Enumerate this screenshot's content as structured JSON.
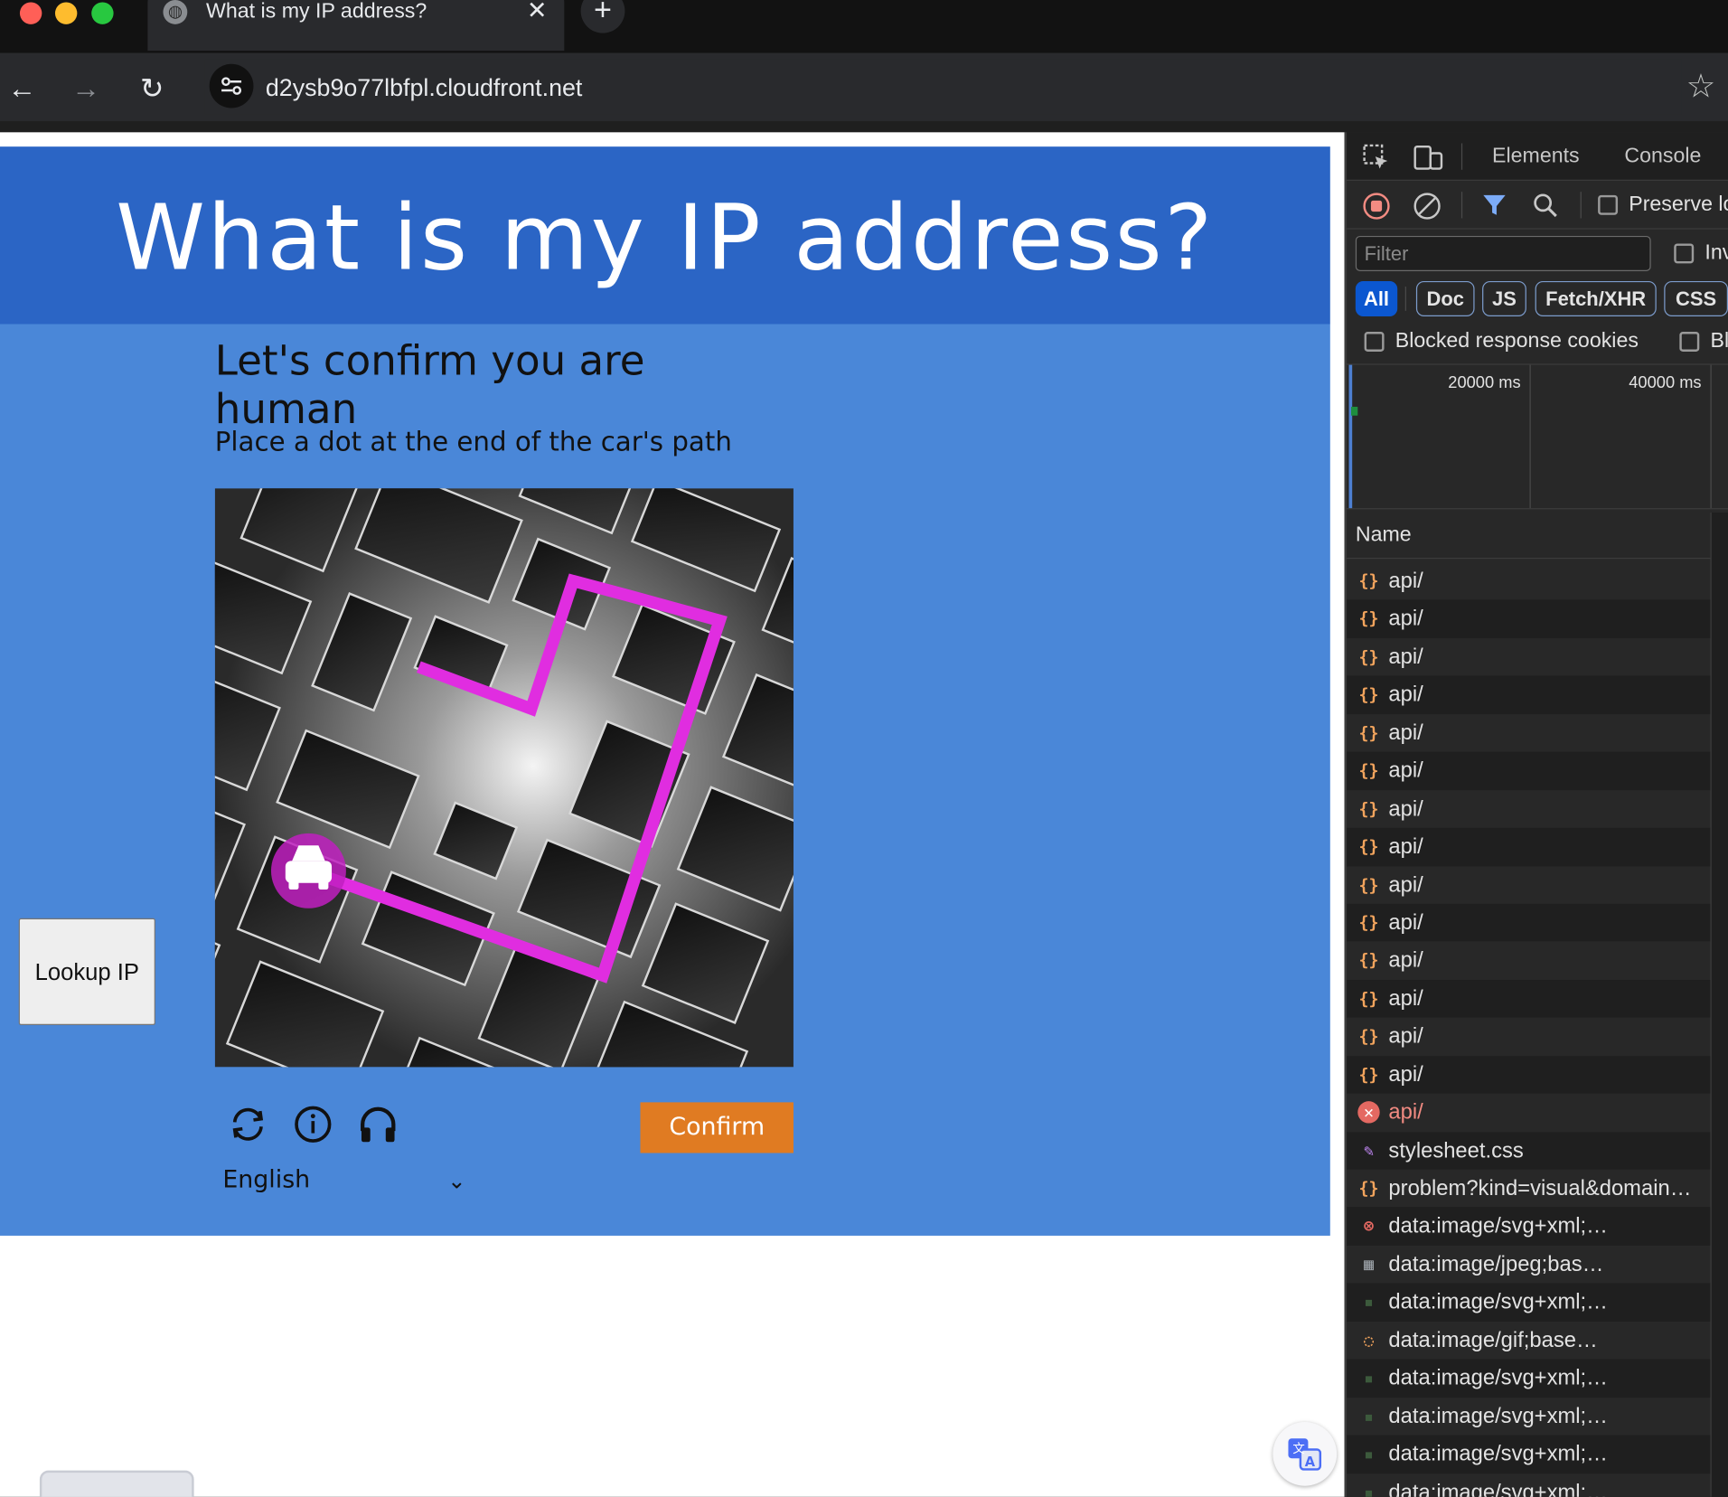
{
  "browser": {
    "tab_title": "What is my IP address?",
    "tab_close": "✕",
    "new_tab": "+",
    "url": "d2ysb9o77lbfpl.cloudfront.net",
    "back": "←",
    "forward": "→",
    "reload": "↻",
    "bookmark": "☆"
  },
  "page": {
    "heading": "What is my IP address?",
    "lookup_button": "Lookup IP"
  },
  "captcha": {
    "title": "Let's confirm you are human",
    "instruction": "Place a dot at the end of the car's path",
    "confirm_label": "Confirm",
    "language": "English",
    "icons": [
      "refresh-icon",
      "info-icon",
      "audio-icon"
    ]
  },
  "devtools": {
    "tabs": [
      "Elements",
      "Console"
    ],
    "preserve_log": "Preserve lo",
    "filter_placeholder": "Filter",
    "invert": "Inv",
    "chips": [
      "All",
      "Doc",
      "JS",
      "Fetch/XHR",
      "CSS"
    ],
    "blocked_cookies": "Blocked response cookies",
    "blocked_requests": "Bl",
    "timeline_labels": [
      "20000 ms",
      "40000 ms"
    ],
    "name_header": "Name",
    "requests": [
      {
        "name": "api/",
        "type": "fetch"
      },
      {
        "name": "api/",
        "type": "fetch"
      },
      {
        "name": "api/",
        "type": "fetch"
      },
      {
        "name": "api/",
        "type": "fetch"
      },
      {
        "name": "api/",
        "type": "fetch"
      },
      {
        "name": "api/",
        "type": "fetch"
      },
      {
        "name": "api/",
        "type": "fetch"
      },
      {
        "name": "api/",
        "type": "fetch"
      },
      {
        "name": "api/",
        "type": "fetch"
      },
      {
        "name": "api/",
        "type": "fetch"
      },
      {
        "name": "api/",
        "type": "fetch"
      },
      {
        "name": "api/",
        "type": "fetch"
      },
      {
        "name": "api/",
        "type": "fetch"
      },
      {
        "name": "api/",
        "type": "fetch"
      },
      {
        "name": "api/",
        "type": "error"
      },
      {
        "name": "stylesheet.css",
        "type": "css"
      },
      {
        "name": "problem?kind=visual&domain…",
        "type": "fetch"
      },
      {
        "name": "data:image/svg+xml;…",
        "type": "svg-error"
      },
      {
        "name": "data:image/jpeg;bas…",
        "type": "image"
      },
      {
        "name": "data:image/svg+xml;…",
        "type": "svg"
      },
      {
        "name": "data:image/gif;base…",
        "type": "gif"
      },
      {
        "name": "data:image/svg+xml;…",
        "type": "svg"
      },
      {
        "name": "data:image/svg+xml;…",
        "type": "svg"
      },
      {
        "name": "data:image/svg+xml;…",
        "type": "svg"
      },
      {
        "name": "data:image/svg+xml;…",
        "type": "svg"
      }
    ]
  },
  "colors": {
    "header_blue": "#2b65c5",
    "body_blue": "#4a87d8",
    "confirm_orange": "#e07b22",
    "path_magenta": "#e02de0"
  }
}
